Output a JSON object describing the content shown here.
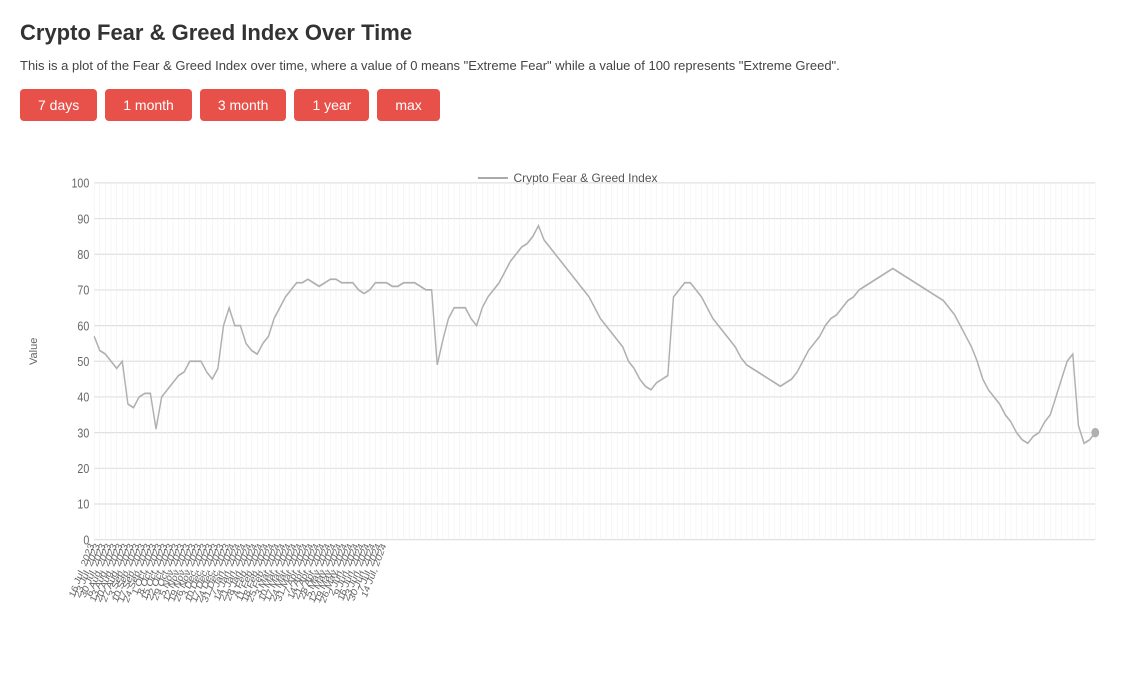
{
  "page": {
    "title": "Crypto Fear & Greed Index Over Time",
    "description": "This is a plot of the Fear & Greed Index over time, where a value of 0 means \"Extreme Fear\" while a value of 100 represents \"Extreme Greed\".",
    "legend_label": "Crypto Fear & Greed Index",
    "y_axis_label": "Value"
  },
  "buttons": [
    {
      "label": "7 days",
      "id": "btn-7days"
    },
    {
      "label": "1 month",
      "id": "btn-1month"
    },
    {
      "label": "3 month",
      "id": "btn-3month"
    },
    {
      "label": "1 year",
      "id": "btn-1year"
    },
    {
      "label": "max",
      "id": "btn-max"
    }
  ],
  "colors": {
    "button_bg": "#e8504a",
    "line_color": "#b0b0b0",
    "grid_color": "#e0e0e0",
    "axis_color": "#999"
  },
  "chart": {
    "y_ticks": [
      0,
      10,
      20,
      30,
      40,
      50,
      60,
      70,
      80,
      90,
      100
    ],
    "x_labels": [
      "16 Jul, 2023",
      "23 Jul, 2023",
      "30 Jul, 2023",
      "6 Aug, 2023",
      "13 Aug, 2023",
      "20 Aug, 2023",
      "27 Aug, 2023",
      "3 Sep, 2023",
      "10 Sep, 2023",
      "17 Sep, 2023",
      "24 Sep, 2023",
      "1 Oct, 2023",
      "8 Oct, 2023",
      "15 Oct, 2023",
      "22 Oct, 2023",
      "29 Oct, 2023",
      "5 Nov, 2023",
      "12 Nov, 2023",
      "19 Nov, 2023",
      "26 Nov, 2023",
      "3 Dec, 2023",
      "10 Dec, 2023",
      "17 Dec, 2023",
      "24 Dec, 2023",
      "31 Dec, 2023",
      "7 Jan, 2024",
      "14 Jan, 2024",
      "21 Jan, 2024",
      "28 Jan, 2024",
      "4 Feb, 2024",
      "11 Feb, 2024",
      "18 Feb, 2024",
      "25 Feb, 2024",
      "3 Mar, 2024",
      "10 Mar, 2024",
      "17 Mar, 2024",
      "24 Mar, 2024",
      "31 Mar, 2024",
      "7 Apr, 2024",
      "14 Apr, 2024",
      "21 Apr, 2024",
      "28 Apr, 2024",
      "5 May, 2024",
      "12 May, 2024",
      "19 May, 2024",
      "26 May, 2024",
      "2 Jun, 2024",
      "9 Jun, 2024",
      "16 Jun, 2024",
      "23 Jun, 2024",
      "30 Jun, 2024",
      "7 Jul, 2024",
      "14 Jul, 2024"
    ],
    "data_points": [
      57,
      53,
      52,
      50,
      48,
      50,
      38,
      37,
      40,
      41,
      41,
      31,
      40,
      42,
      44,
      46,
      47,
      50,
      50,
      50,
      47,
      45,
      48,
      60,
      65,
      60,
      60,
      55,
      53,
      52,
      55,
      57,
      62,
      65,
      68,
      70,
      72,
      72,
      73,
      72,
      71,
      72,
      73,
      73,
      72,
      72,
      72,
      70,
      69,
      70,
      72,
      72,
      72,
      71,
      71,
      72,
      72,
      72,
      71,
      70,
      70,
      49,
      56,
      62,
      65,
      65,
      65,
      62,
      60,
      65,
      68,
      70,
      72,
      75,
      78,
      80,
      82,
      83,
      85,
      88,
      84,
      82,
      80,
      78,
      76,
      74,
      72,
      70,
      68,
      65,
      62,
      60,
      58,
      56,
      54,
      50,
      48,
      45,
      43,
      42,
      44,
      45,
      46,
      68,
      70,
      72,
      72,
      70,
      68,
      65,
      62,
      60,
      58,
      56,
      54,
      51,
      49,
      48,
      47,
      46,
      45,
      44,
      43,
      44,
      45,
      47,
      50,
      53,
      55,
      57,
      60,
      62,
      63,
      65,
      67,
      68,
      70,
      71,
      72,
      73,
      74,
      75,
      76,
      75,
      74,
      73,
      72,
      71,
      70,
      69,
      68,
      67,
      65,
      63,
      60,
      57,
      54,
      50,
      45,
      42,
      40,
      38,
      35,
      33,
      30,
      28,
      27,
      29,
      30,
      33,
      35,
      40,
      45,
      50,
      52,
      32,
      27,
      28,
      30
    ]
  }
}
